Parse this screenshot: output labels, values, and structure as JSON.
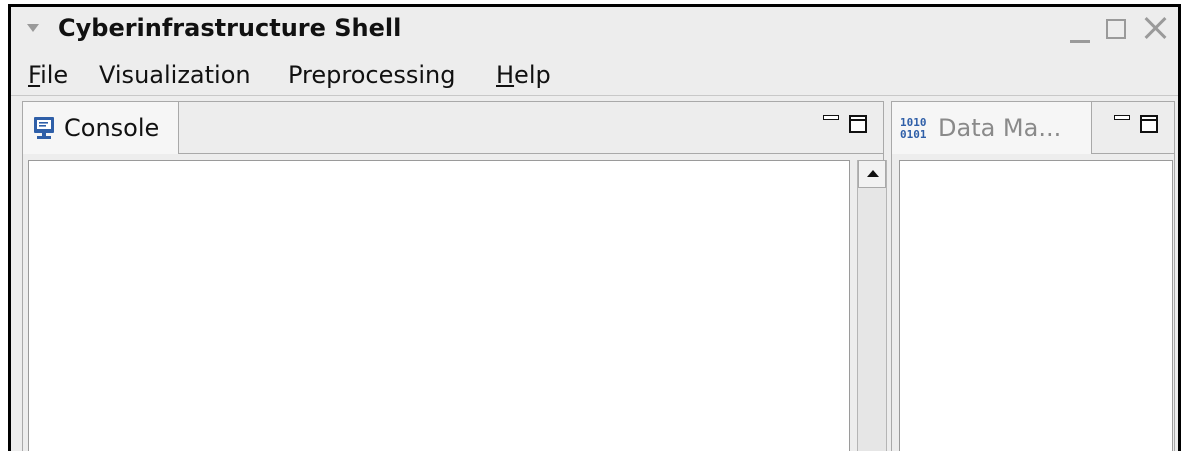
{
  "window": {
    "title": "Cyberinfrastructure Shell"
  },
  "menubar": {
    "items": [
      {
        "label_mnemonic": "F",
        "label_rest": "ile"
      },
      {
        "label": "Visualization"
      },
      {
        "label": "Preprocessing"
      },
      {
        "label_mnemonic": "H",
        "label_rest": "elp"
      }
    ]
  },
  "console_view": {
    "tab_label": "Console",
    "icon": "monitor-icon"
  },
  "data_manager_view": {
    "tab_label": "Data Ma...",
    "icon": "binary-data-icon"
  },
  "colors": {
    "icon_blue": "#2f5fa8",
    "inactive_text": "#8a8a8a",
    "chrome_bg": "#ededed"
  }
}
